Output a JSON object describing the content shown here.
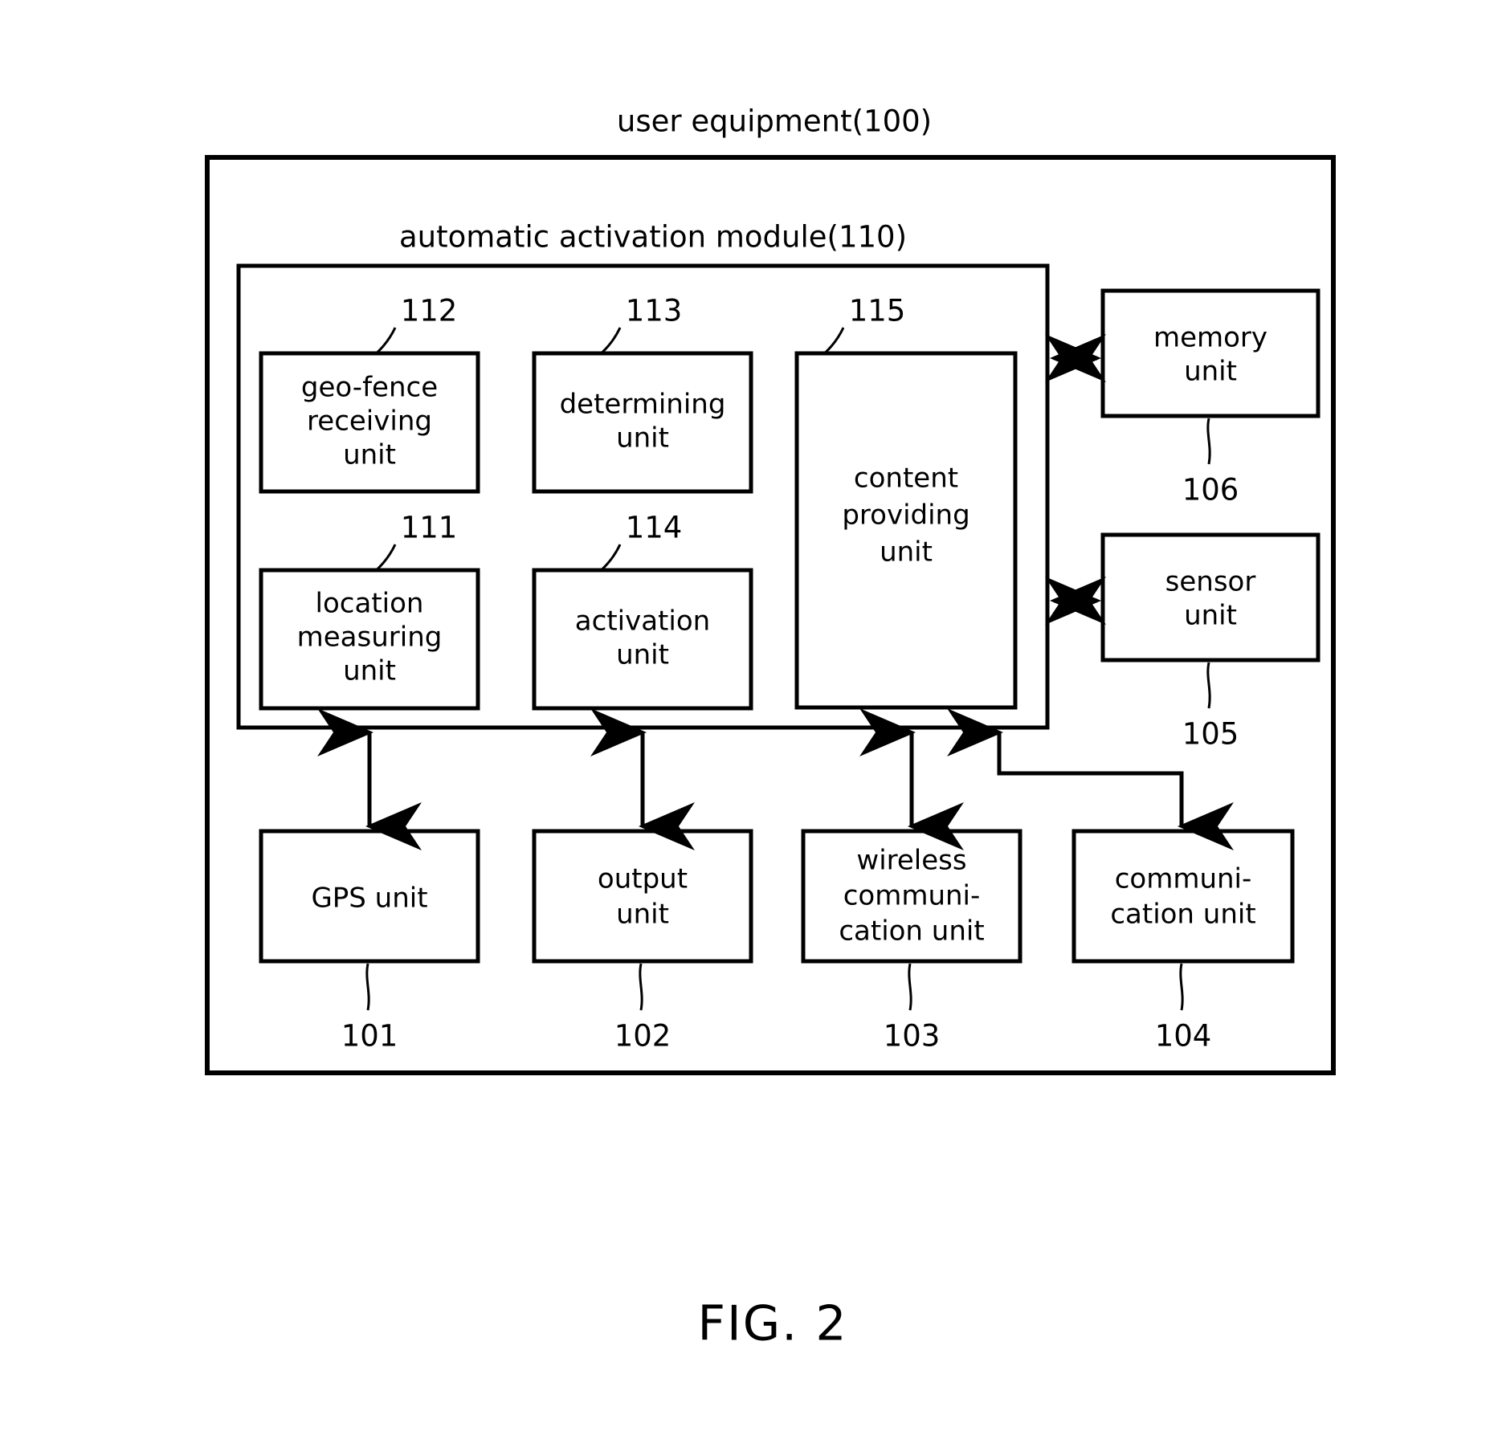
{
  "figure": {
    "caption": "FIG. 2",
    "outer_title": "user equipment(100)",
    "module_title": "automatic activation module(110)"
  },
  "module_blocks": [
    {
      "id": "geo-fence-receiving-unit",
      "label": "geo-fence\nreceiving\nunit",
      "ref": "112"
    },
    {
      "id": "determining-unit",
      "label": "determining\nunit",
      "ref": "113"
    },
    {
      "id": "content-providing-unit",
      "label": "content\nproviding\nunit",
      "ref": "115"
    },
    {
      "id": "location-measuring-unit",
      "label": "location\nmeasuring\nunit",
      "ref": "111"
    },
    {
      "id": "activation-unit",
      "label": "activation\nunit",
      "ref": "114"
    }
  ],
  "side_blocks": [
    {
      "id": "memory-unit",
      "label": "memory\nunit",
      "ref": "106"
    },
    {
      "id": "sensor-unit",
      "label": "sensor\nunit",
      "ref": "105"
    }
  ],
  "bottom_blocks": [
    {
      "id": "gps-unit",
      "label": "GPS unit",
      "ref": "101"
    },
    {
      "id": "output-unit",
      "label": "output\nunit",
      "ref": "102"
    },
    {
      "id": "wireless-communication-unit",
      "label": "wireless\ncommuni-\ncation unit",
      "ref": "103"
    },
    {
      "id": "communication-unit",
      "label": "communi-\ncation unit",
      "ref": "104"
    }
  ],
  "labels": {
    "b112_l1": "geo-fence",
    "b112_l2": "receiving",
    "b112_l3": "unit",
    "b113_l1": "determining",
    "b113_l2": "unit",
    "b115_l1": "content",
    "b115_l2": "providing",
    "b115_l3": "unit",
    "b111_l1": "location",
    "b111_l2": "measuring",
    "b111_l3": "unit",
    "b114_l1": "activation",
    "b114_l2": "unit",
    "memory_l1": "memory",
    "memory_l2": "unit",
    "sensor_l1": "sensor",
    "sensor_l2": "unit",
    "gps_l1": "GPS unit",
    "output_l1": "output",
    "output_l2": "unit",
    "wireless_l1": "wireless",
    "wireless_l2": "communi-",
    "wireless_l3": "cation unit",
    "comm_l1": "communi-",
    "comm_l2": "cation unit"
  },
  "refs": {
    "r112": "112",
    "r113": "113",
    "r115": "115",
    "r111": "111",
    "r114": "114",
    "r106": "106",
    "r105": "105",
    "r101": "101",
    "r102": "102",
    "r103": "103",
    "r104": "104"
  },
  "colors": {
    "stroke": "#000000",
    "background": "#ffffff"
  }
}
